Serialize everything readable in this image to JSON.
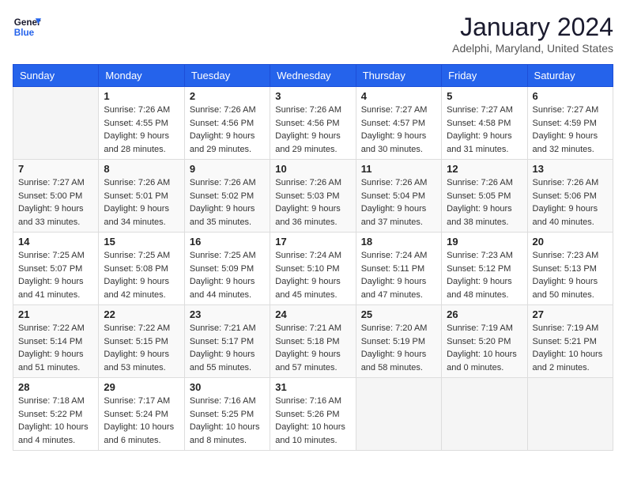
{
  "header": {
    "logo_line1": "General",
    "logo_line2": "Blue",
    "month": "January 2024",
    "location": "Adelphi, Maryland, United States"
  },
  "days_of_week": [
    "Sunday",
    "Monday",
    "Tuesday",
    "Wednesday",
    "Thursday",
    "Friday",
    "Saturday"
  ],
  "weeks": [
    [
      {
        "day": "",
        "sunrise": "",
        "sunset": "",
        "daylight": ""
      },
      {
        "day": "1",
        "sunrise": "Sunrise: 7:26 AM",
        "sunset": "Sunset: 4:55 PM",
        "daylight": "Daylight: 9 hours and 28 minutes."
      },
      {
        "day": "2",
        "sunrise": "Sunrise: 7:26 AM",
        "sunset": "Sunset: 4:56 PM",
        "daylight": "Daylight: 9 hours and 29 minutes."
      },
      {
        "day": "3",
        "sunrise": "Sunrise: 7:26 AM",
        "sunset": "Sunset: 4:56 PM",
        "daylight": "Daylight: 9 hours and 29 minutes."
      },
      {
        "day": "4",
        "sunrise": "Sunrise: 7:27 AM",
        "sunset": "Sunset: 4:57 PM",
        "daylight": "Daylight: 9 hours and 30 minutes."
      },
      {
        "day": "5",
        "sunrise": "Sunrise: 7:27 AM",
        "sunset": "Sunset: 4:58 PM",
        "daylight": "Daylight: 9 hours and 31 minutes."
      },
      {
        "day": "6",
        "sunrise": "Sunrise: 7:27 AM",
        "sunset": "Sunset: 4:59 PM",
        "daylight": "Daylight: 9 hours and 32 minutes."
      }
    ],
    [
      {
        "day": "7",
        "sunrise": "Sunrise: 7:27 AM",
        "sunset": "Sunset: 5:00 PM",
        "daylight": "Daylight: 9 hours and 33 minutes."
      },
      {
        "day": "8",
        "sunrise": "Sunrise: 7:26 AM",
        "sunset": "Sunset: 5:01 PM",
        "daylight": "Daylight: 9 hours and 34 minutes."
      },
      {
        "day": "9",
        "sunrise": "Sunrise: 7:26 AM",
        "sunset": "Sunset: 5:02 PM",
        "daylight": "Daylight: 9 hours and 35 minutes."
      },
      {
        "day": "10",
        "sunrise": "Sunrise: 7:26 AM",
        "sunset": "Sunset: 5:03 PM",
        "daylight": "Daylight: 9 hours and 36 minutes."
      },
      {
        "day": "11",
        "sunrise": "Sunrise: 7:26 AM",
        "sunset": "Sunset: 5:04 PM",
        "daylight": "Daylight: 9 hours and 37 minutes."
      },
      {
        "day": "12",
        "sunrise": "Sunrise: 7:26 AM",
        "sunset": "Sunset: 5:05 PM",
        "daylight": "Daylight: 9 hours and 38 minutes."
      },
      {
        "day": "13",
        "sunrise": "Sunrise: 7:26 AM",
        "sunset": "Sunset: 5:06 PM",
        "daylight": "Daylight: 9 hours and 40 minutes."
      }
    ],
    [
      {
        "day": "14",
        "sunrise": "Sunrise: 7:25 AM",
        "sunset": "Sunset: 5:07 PM",
        "daylight": "Daylight: 9 hours and 41 minutes."
      },
      {
        "day": "15",
        "sunrise": "Sunrise: 7:25 AM",
        "sunset": "Sunset: 5:08 PM",
        "daylight": "Daylight: 9 hours and 42 minutes."
      },
      {
        "day": "16",
        "sunrise": "Sunrise: 7:25 AM",
        "sunset": "Sunset: 5:09 PM",
        "daylight": "Daylight: 9 hours and 44 minutes."
      },
      {
        "day": "17",
        "sunrise": "Sunrise: 7:24 AM",
        "sunset": "Sunset: 5:10 PM",
        "daylight": "Daylight: 9 hours and 45 minutes."
      },
      {
        "day": "18",
        "sunrise": "Sunrise: 7:24 AM",
        "sunset": "Sunset: 5:11 PM",
        "daylight": "Daylight: 9 hours and 47 minutes."
      },
      {
        "day": "19",
        "sunrise": "Sunrise: 7:23 AM",
        "sunset": "Sunset: 5:12 PM",
        "daylight": "Daylight: 9 hours and 48 minutes."
      },
      {
        "day": "20",
        "sunrise": "Sunrise: 7:23 AM",
        "sunset": "Sunset: 5:13 PM",
        "daylight": "Daylight: 9 hours and 50 minutes."
      }
    ],
    [
      {
        "day": "21",
        "sunrise": "Sunrise: 7:22 AM",
        "sunset": "Sunset: 5:14 PM",
        "daylight": "Daylight: 9 hours and 51 minutes."
      },
      {
        "day": "22",
        "sunrise": "Sunrise: 7:22 AM",
        "sunset": "Sunset: 5:15 PM",
        "daylight": "Daylight: 9 hours and 53 minutes."
      },
      {
        "day": "23",
        "sunrise": "Sunrise: 7:21 AM",
        "sunset": "Sunset: 5:17 PM",
        "daylight": "Daylight: 9 hours and 55 minutes."
      },
      {
        "day": "24",
        "sunrise": "Sunrise: 7:21 AM",
        "sunset": "Sunset: 5:18 PM",
        "daylight": "Daylight: 9 hours and 57 minutes."
      },
      {
        "day": "25",
        "sunrise": "Sunrise: 7:20 AM",
        "sunset": "Sunset: 5:19 PM",
        "daylight": "Daylight: 9 hours and 58 minutes."
      },
      {
        "day": "26",
        "sunrise": "Sunrise: 7:19 AM",
        "sunset": "Sunset: 5:20 PM",
        "daylight": "Daylight: 10 hours and 0 minutes."
      },
      {
        "day": "27",
        "sunrise": "Sunrise: 7:19 AM",
        "sunset": "Sunset: 5:21 PM",
        "daylight": "Daylight: 10 hours and 2 minutes."
      }
    ],
    [
      {
        "day": "28",
        "sunrise": "Sunrise: 7:18 AM",
        "sunset": "Sunset: 5:22 PM",
        "daylight": "Daylight: 10 hours and 4 minutes."
      },
      {
        "day": "29",
        "sunrise": "Sunrise: 7:17 AM",
        "sunset": "Sunset: 5:24 PM",
        "daylight": "Daylight: 10 hours and 6 minutes."
      },
      {
        "day": "30",
        "sunrise": "Sunrise: 7:16 AM",
        "sunset": "Sunset: 5:25 PM",
        "daylight": "Daylight: 10 hours and 8 minutes."
      },
      {
        "day": "31",
        "sunrise": "Sunrise: 7:16 AM",
        "sunset": "Sunset: 5:26 PM",
        "daylight": "Daylight: 10 hours and 10 minutes."
      },
      {
        "day": "",
        "sunrise": "",
        "sunset": "",
        "daylight": ""
      },
      {
        "day": "",
        "sunrise": "",
        "sunset": "",
        "daylight": ""
      },
      {
        "day": "",
        "sunrise": "",
        "sunset": "",
        "daylight": ""
      }
    ]
  ]
}
